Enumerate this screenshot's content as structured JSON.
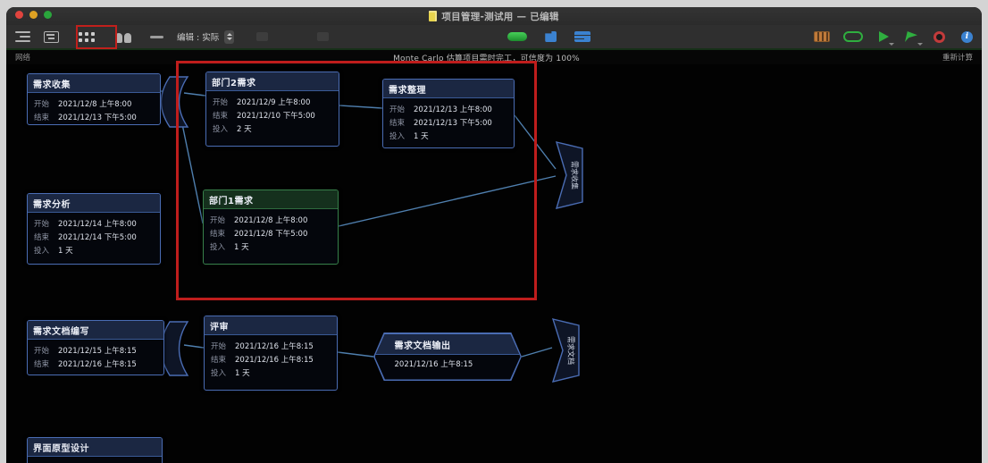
{
  "window": {
    "title": "项目管理-测试用 — 已编辑"
  },
  "toolbar": {
    "edit_mode_label": "编辑 : 实际",
    "info_glyph": "i",
    "icons": [
      "outline-view-icon",
      "gantt-view-icon",
      "network-view-icon",
      "resources-view-icon",
      "separator-dash-icon",
      "edit-mode-stepper",
      "dimmed-tool-icon-1",
      "dimmed-tool-icon-2",
      "green-pill-icon",
      "reschedule-icon",
      "leveling-icon",
      "violations-grid-icon",
      "monte-carlo-oval-icon",
      "catch-up-arrow-icon",
      "publish-flag-icon",
      "record-icon",
      "info-icon"
    ],
    "highlight_color": "#c1201c"
  },
  "notice_bar": {
    "view_label": "网络",
    "message": "Monte Carlo 估算项目需时完工，可信度为 100%",
    "action_label": "重新计算"
  },
  "annotations": {
    "color": "#bf1d1c"
  },
  "diagram": {
    "accent_blue": "#4a6cb3",
    "accent_green": "#37804a",
    "connector_color": "#4f7fae",
    "nodes": [
      {
        "kind": "group",
        "color": "blue",
        "title": "需求收集",
        "rows": [
          {
            "label": "开始",
            "value": "2021/12/8 上午8:00"
          },
          {
            "label": "结束",
            "value": "2021/12/13 下午5:00"
          }
        ]
      },
      {
        "kind": "task",
        "color": "blue",
        "title": "部门2需求",
        "rows": [
          {
            "label": "开始",
            "value": "2021/12/9 上午8:00"
          },
          {
            "label": "结束",
            "value": "2021/12/10 下午5:00"
          },
          {
            "label": "投入",
            "value": "2 天"
          }
        ]
      },
      {
        "kind": "task",
        "color": "blue",
        "title": "需求整理",
        "rows": [
          {
            "label": "开始",
            "value": "2021/12/13 上午8:00"
          },
          {
            "label": "结束",
            "value": "2021/12/13 下午5:00"
          },
          {
            "label": "投入",
            "value": "1 天"
          }
        ]
      },
      {
        "kind": "task",
        "color": "blue",
        "title": "需求分析",
        "rows": [
          {
            "label": "开始",
            "value": "2021/12/14 上午8:00"
          },
          {
            "label": "结束",
            "value": "2021/12/14 下午5:00"
          },
          {
            "label": "投入",
            "value": "1 天"
          }
        ]
      },
      {
        "kind": "task",
        "color": "green",
        "title": "部门1需求",
        "rows": [
          {
            "label": "开始",
            "value": "2021/12/8 上午8:00"
          },
          {
            "label": "结束",
            "value": "2021/12/8 下午5:00"
          },
          {
            "label": "投入",
            "value": "1 天"
          }
        ]
      },
      {
        "kind": "group-end",
        "title": "需求收集"
      },
      {
        "kind": "group",
        "color": "blue",
        "title": "需求文档编写",
        "rows": [
          {
            "label": "开始",
            "value": "2021/12/15 上午8:15"
          },
          {
            "label": "结束",
            "value": "2021/12/16 上午8:15"
          }
        ]
      },
      {
        "kind": "task",
        "color": "blue",
        "title": "评审",
        "rows": [
          {
            "label": "开始",
            "value": "2021/12/16 上午8:15"
          },
          {
            "label": "结束",
            "value": "2021/12/16 上午8:15"
          },
          {
            "label": "投入",
            "value": "1 天"
          }
        ]
      },
      {
        "kind": "milestone",
        "color": "blue",
        "title": "需求文档输出",
        "date": "2021/12/16 上午8:15"
      },
      {
        "kind": "group-end",
        "title": "需求文档"
      },
      {
        "kind": "task",
        "color": "blue",
        "title": "界面原型设计",
        "rows": []
      }
    ]
  }
}
